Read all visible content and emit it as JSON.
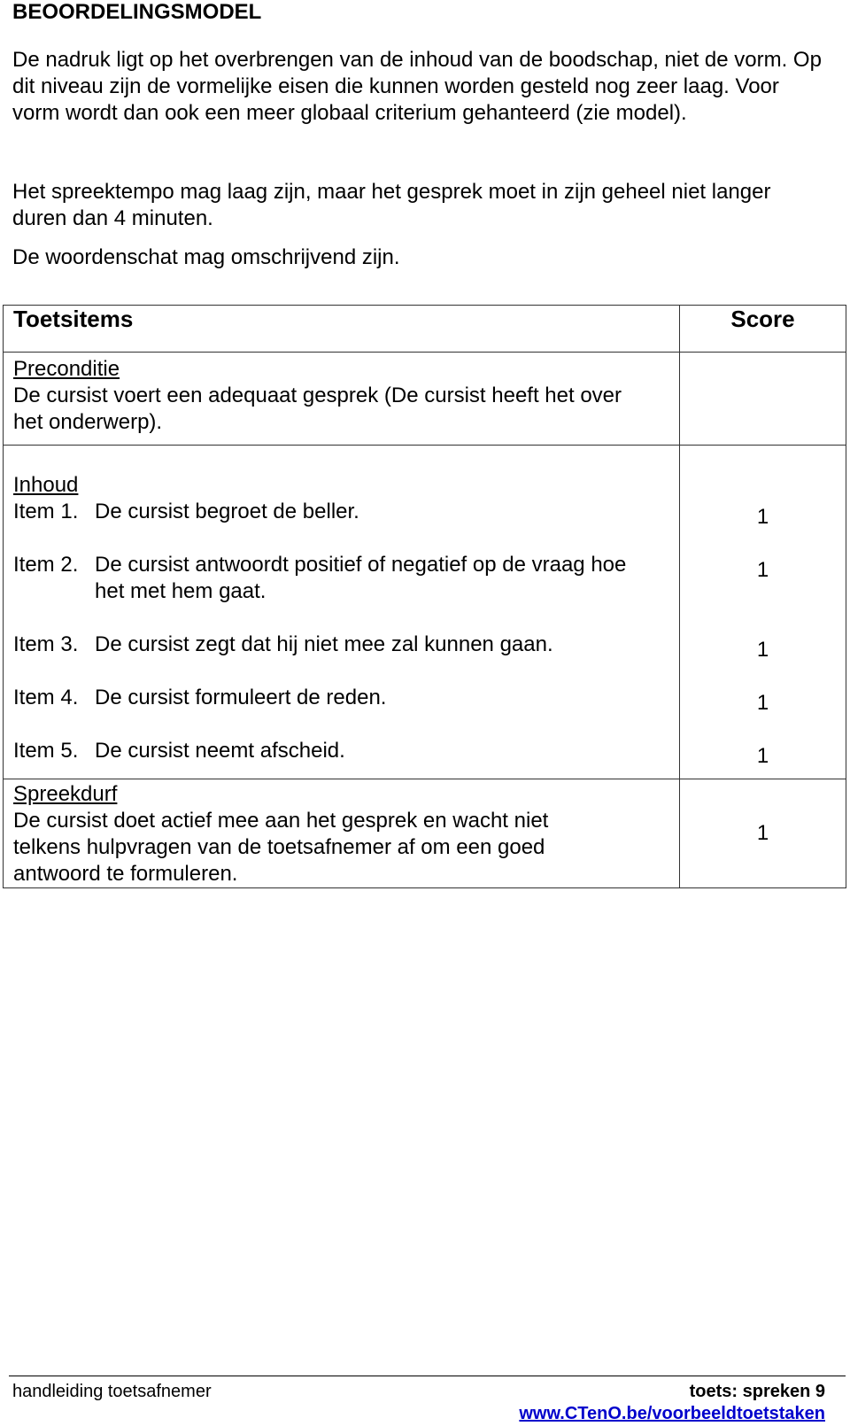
{
  "title": "BEOORDELINGSMODEL",
  "intro": [
    "De nadruk ligt op het overbrengen van de inhoud van de boodschap, niet de vorm. Op dit niveau zijn de vormelijke eisen die kunnen worden gesteld nog zeer laag. Voor vorm wordt dan ook een meer globaal criterium gehanteerd (zie model).",
    "Het spreektempo mag laag zijn, maar het gesprek moet in zijn geheel niet langer duren dan 4 minuten.",
    "De woordenschat mag omschrijvend zijn."
  ],
  "table": {
    "headers": {
      "item": "Toetsitems",
      "score": "Score"
    },
    "precondition": {
      "title": "Preconditie",
      "text": "De cursist voert een adequaat gesprek (De cursist heeft het over het onderwerp)."
    },
    "content": {
      "title": "Inhoud",
      "items": [
        {
          "label": "Item 1.",
          "text": "De cursist begroet de beller.",
          "score": "1"
        },
        {
          "label": "Item 2.",
          "text": "De cursist antwoordt positief of negatief op de vraag hoe het met hem gaat.",
          "score": "1"
        },
        {
          "label": "Item 3.",
          "text": "De cursist zegt dat hij niet mee zal kunnen gaan.",
          "score": "1"
        },
        {
          "label": "Item 4.",
          "text": "De cursist formuleert de reden.",
          "score": "1"
        },
        {
          "label": "Item 5.",
          "text": "De cursist neemt afscheid.",
          "score": "1"
        }
      ]
    },
    "fluency": {
      "title": "Spreekdurf",
      "text": "De cursist doet actief mee aan het gesprek en wacht niet telkens hulpvragen van de toetsafnemer af om een goed antwoord te formuleren.",
      "score": "1"
    }
  },
  "footer": {
    "left": "handleiding toetsafnemer",
    "right": "toets: spreken 9",
    "link": "www.CTenO.be/voorbeeldtoetstaken",
    "link_color": "#0000cc"
  }
}
